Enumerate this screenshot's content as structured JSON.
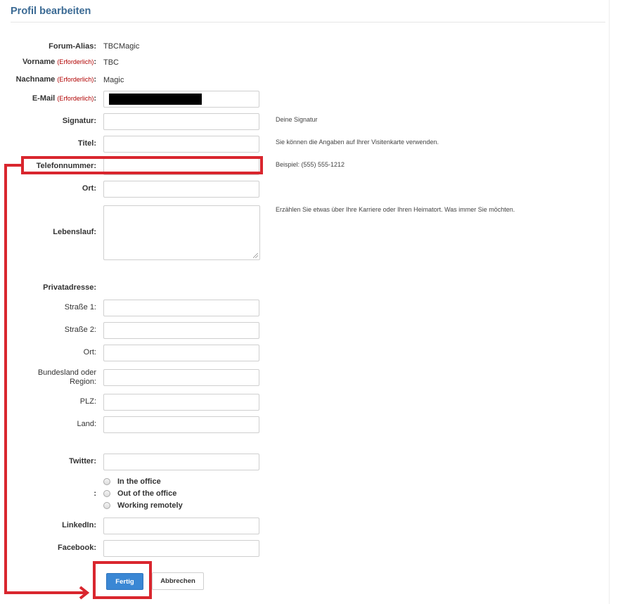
{
  "page": {
    "title": "Profil bearbeiten"
  },
  "fields": {
    "forum_alias": {
      "label": "Forum-Alias:",
      "value": "TBCMagic"
    },
    "vorname": {
      "label": "Vorname",
      "required": "(Erforderlich)",
      "colon": ":",
      "value": "TBC"
    },
    "nachname": {
      "label": "Nachname",
      "required": "(Erforderlich)",
      "colon": ":",
      "value": "Magic"
    },
    "email": {
      "label": "E-Mail",
      "required": "(Erforderlich)",
      "colon": ":",
      "value": ""
    },
    "signatur": {
      "label": "Signatur:",
      "value": "",
      "hint": "Deine Signatur"
    },
    "titel": {
      "label": "Titel:",
      "value": "",
      "hint": "Sie können die Angaben auf Ihrer Visitenkarte verwenden."
    },
    "telefon": {
      "label": "Telefonnummer:",
      "value": "",
      "hint": "Beispiel: (555) 555-1212"
    },
    "ort": {
      "label": "Ort:",
      "value": ""
    },
    "lebenslauf": {
      "label": "Lebenslauf:",
      "value": "",
      "hint": "Erzählen Sie etwas über Ihre Karriere oder Ihren Heimatort. Was immer Sie möchten."
    }
  },
  "address": {
    "section_label": "Privatadresse:",
    "strasse1": {
      "label": "Straße 1:",
      "value": ""
    },
    "strasse2": {
      "label": "Straße 2:",
      "value": ""
    },
    "ort": {
      "label": "Ort:",
      "value": ""
    },
    "region": {
      "label_line1": "Bundesland oder",
      "label_line2": "Region:",
      "value": ""
    },
    "plz": {
      "label": "PLZ:",
      "value": ""
    },
    "land": {
      "label": "Land:",
      "value": ""
    }
  },
  "social": {
    "twitter": {
      "label": "Twitter:",
      "value": ""
    },
    "status_label": ":",
    "status_options": [
      "In the office",
      "Out of the office",
      "Working remotely"
    ],
    "linkedin": {
      "label": "LinkedIn:",
      "value": ""
    },
    "facebook": {
      "label": "Facebook:",
      "value": ""
    }
  },
  "buttons": {
    "submit": "Fertig",
    "cancel": "Abbrechen"
  },
  "annotation": {
    "color": "#d9262e"
  }
}
